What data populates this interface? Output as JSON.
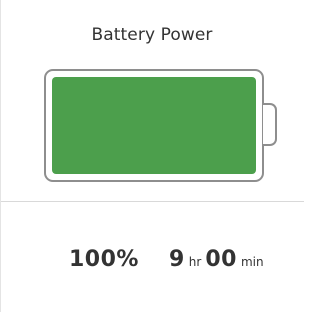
{
  "title": "Battery Power",
  "battery": {
    "percent_label": "100%",
    "level": 1.0,
    "fill_color": "#4c9f4c",
    "outline_color": "#8e8e8e"
  },
  "time_remaining": {
    "hours": "9",
    "hours_unit": "hr",
    "minutes": "00",
    "minutes_unit": "min"
  }
}
